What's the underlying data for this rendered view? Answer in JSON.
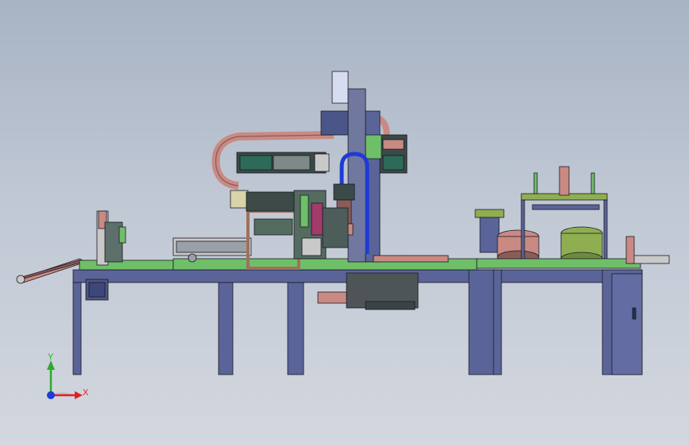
{
  "triad": {
    "x_label": "X",
    "y_label": "Y",
    "x_color": "#e02020",
    "y_color": "#2fa82f",
    "z_color": "#1f3bd6"
  },
  "colors": {
    "frame": "#5a6498",
    "plate": "#6fbf68",
    "copper": "#c98a84",
    "dark": "#3a4a48",
    "olive": "#8fae52",
    "panel": "#7078a0"
  }
}
